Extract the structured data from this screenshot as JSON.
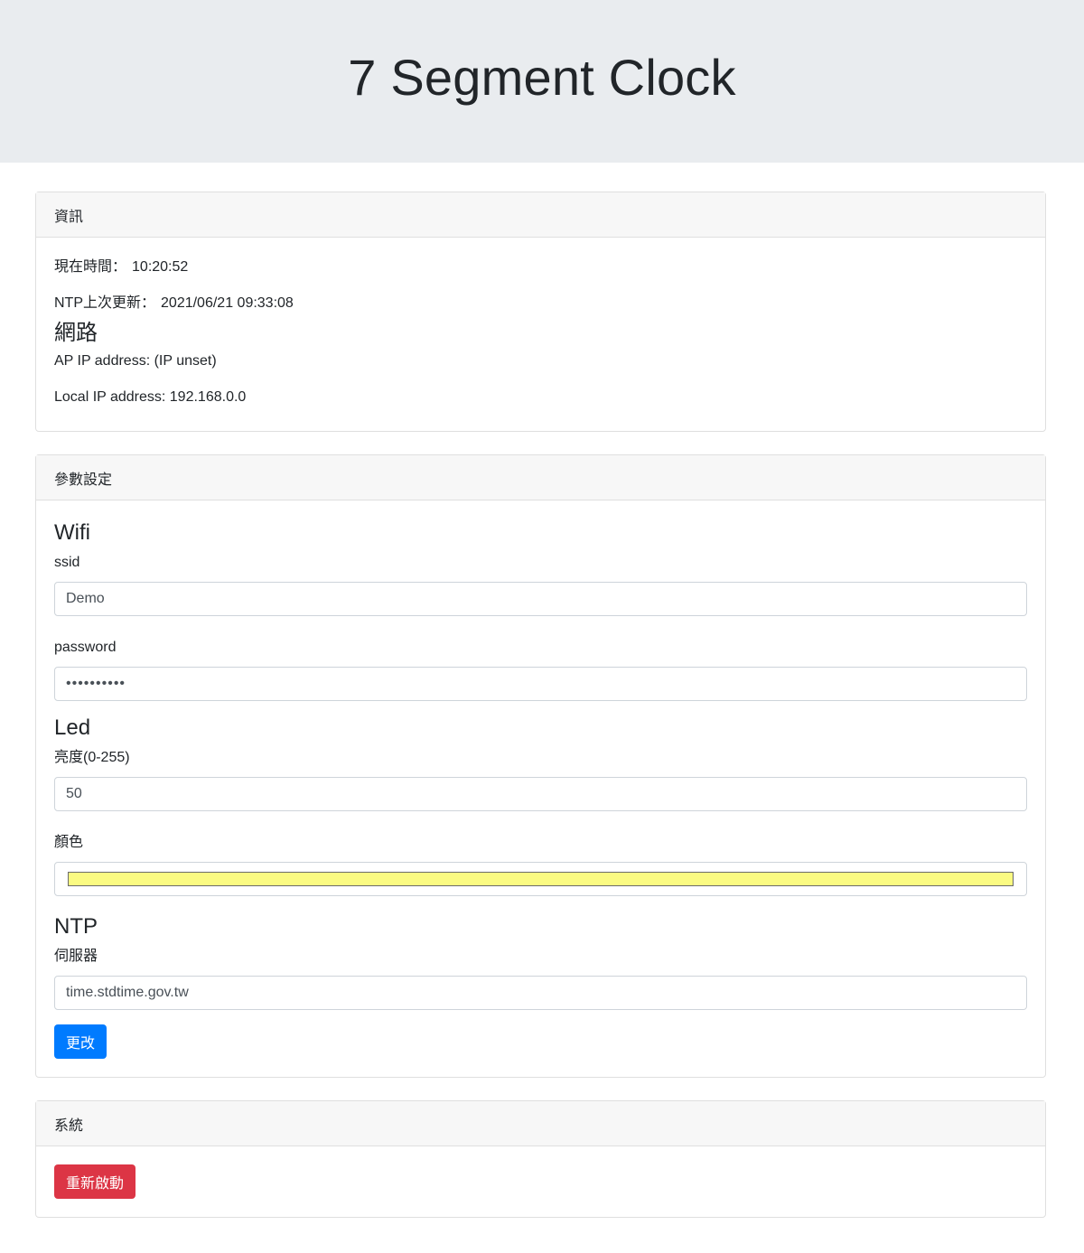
{
  "header": {
    "title": "7 Segment Clock"
  },
  "info_card": {
    "header": "資訊",
    "current_time_label": "現在時間：",
    "current_time_value": "10:20:52",
    "ntp_last_label": "NTP上次更新：",
    "ntp_last_value": "2021/06/21 09:33:08",
    "network_heading": "網路",
    "ap_ip": "AP IP address: (IP unset)",
    "local_ip": "Local IP address: 192.168.0.0"
  },
  "settings_card": {
    "header": "參數設定",
    "wifi_heading": "Wifi",
    "ssid_label": "ssid",
    "ssid_value": "Demo",
    "password_label": "password",
    "password_value": "••••••••••",
    "led_heading": "Led",
    "brightness_label": "亮度(0-255)",
    "brightness_value": "50",
    "color_label": "顏色",
    "color_value": "#fbfb82",
    "ntp_heading": "NTP",
    "server_label": "伺服器",
    "server_value": "time.stdtime.gov.tw",
    "submit_label": "更改"
  },
  "system_card": {
    "header": "系統",
    "restart_label": "重新啟動"
  },
  "colors": {
    "primary": "#007bff",
    "danger": "#dc3545",
    "jumbotron": "#e9ecef"
  }
}
